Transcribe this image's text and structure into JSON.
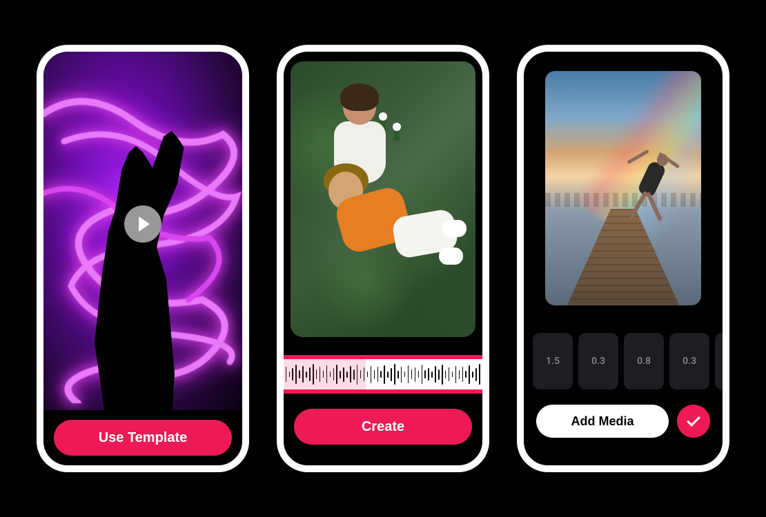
{
  "phone1": {
    "button_label": "Use Template"
  },
  "phone2": {
    "button_label": "Create"
  },
  "phone3": {
    "clips": [
      "1.5",
      "0.3",
      "0.8",
      "0.3"
    ],
    "add_media_label": "Add Media"
  }
}
